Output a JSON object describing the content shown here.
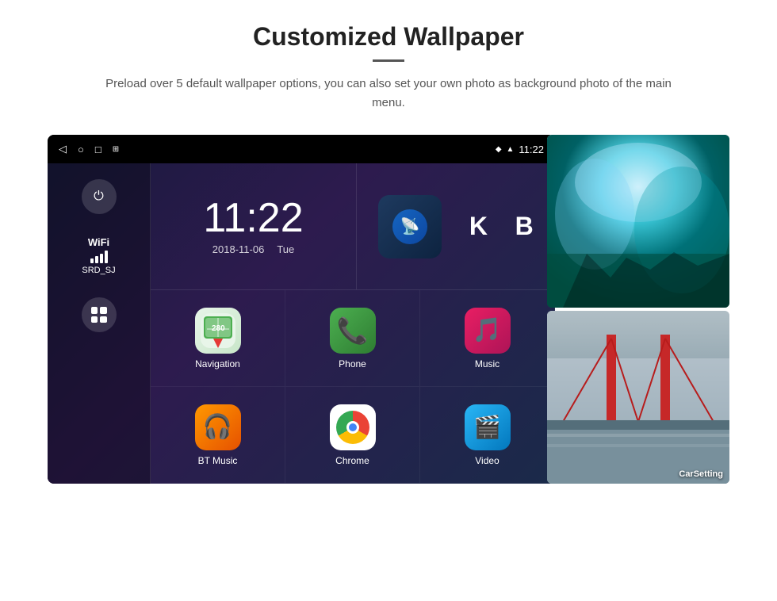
{
  "header": {
    "title": "Customized Wallpaper",
    "subtitle": "Preload over 5 default wallpaper options, you can also set your own photo as background photo of the main menu."
  },
  "device": {
    "statusBar": {
      "time": "11:22",
      "navBack": "◁",
      "navHome": "○",
      "navRecent": "□",
      "navScreenshot": "⊞"
    },
    "clock": {
      "time": "11:22",
      "date": "2018-11-06",
      "day": "Tue"
    },
    "sidebar": {
      "wifiLabel": "WiFi",
      "wifiNetwork": "SRD_SJ"
    },
    "apps": [
      {
        "name": "Navigation",
        "icon": "maps"
      },
      {
        "name": "Phone",
        "icon": "phone"
      },
      {
        "name": "Music",
        "icon": "music"
      },
      {
        "name": "BT Music",
        "icon": "bt"
      },
      {
        "name": "Chrome",
        "icon": "chrome"
      },
      {
        "name": "Video",
        "icon": "video"
      }
    ],
    "wallpapers": [
      {
        "label": "",
        "type": "ice"
      },
      {
        "label": "CarSetting",
        "type": "bridge"
      }
    ]
  }
}
